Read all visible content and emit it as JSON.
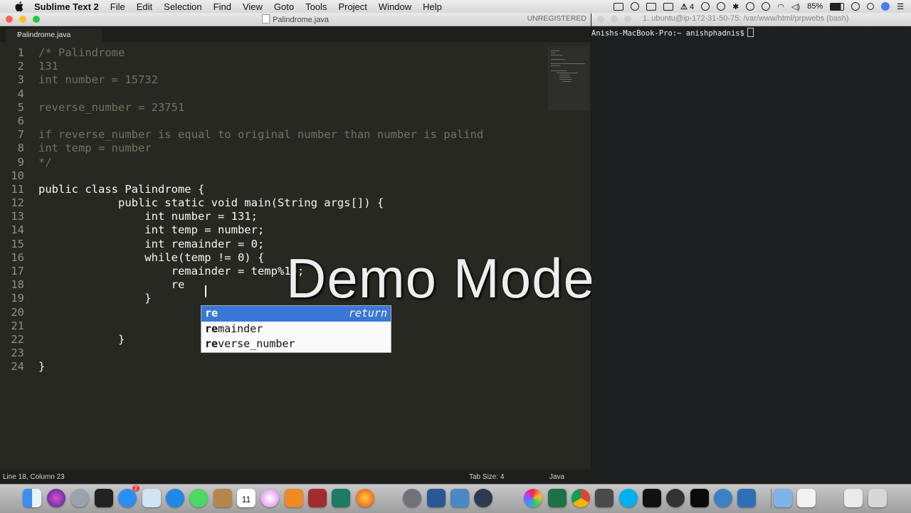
{
  "menubar": {
    "app_name": "Sublime Text 2",
    "items": [
      "File",
      "Edit",
      "Selection",
      "Find",
      "View",
      "Goto",
      "Tools",
      "Project",
      "Window",
      "Help"
    ],
    "status": {
      "notification_count": "4",
      "battery": "85%"
    }
  },
  "sublime": {
    "window_title": "Palindrome.java",
    "unregistered": "UNREGISTERED",
    "tab_label": "Palindrome.java",
    "line_numbers": [
      "1",
      "2",
      "3",
      "4",
      "5",
      "6",
      "7",
      "8",
      "9",
      "10",
      "11",
      "12",
      "13",
      "14",
      "15",
      "16",
      "17",
      "18",
      "19",
      "20",
      "21",
      "22",
      "23",
      "24"
    ],
    "code_lines": [
      "/* Palindrome",
      "131",
      "int number = 15732",
      "",
      "reverse_number = 23751",
      "",
      "if reverse_number is equal to original number than number is palind",
      "int temp = number",
      "*/",
      "",
      "public class Palindrome {",
      "            public static void main(String args[]) {",
      "                int number = 131;",
      "                int temp = number;",
      "                int remainder = 0;",
      "                while(temp != 0) {",
      "                    remainder = temp%10;",
      "                    re",
      "                }",
      "",
      "",
      "            }",
      "",
      "}"
    ],
    "autocomplete": [
      {
        "match": "re",
        "rest": "",
        "hint": "return"
      },
      {
        "match": "re",
        "rest": "mainder",
        "hint": ""
      },
      {
        "match": "re",
        "rest": "verse_number",
        "hint": ""
      }
    ],
    "overlay_text": "Demo Mode",
    "status_position": "Line 18, Column 23",
    "status_tab_size": "Tab Size: 4",
    "status_syntax": "Java"
  },
  "terminal": {
    "title": "1. ubuntu@ip-172-31-50-75: /var/www/html/prpwebs (bash)",
    "prompt": "Anishs-MacBook-Pro:~ anishphadnis$"
  },
  "dock": {
    "apps": [
      "finder",
      "siri",
      "launchpad",
      "photo-booth",
      "app-store",
      "preview",
      "safari",
      "messages",
      "contacts",
      "calendar",
      "itunes",
      "ibooks",
      "photo-app",
      "palm-app",
      "firefox",
      "system-preferences",
      "word",
      "remote-desktop",
      "quicktime",
      "photos",
      "excel",
      "chrome",
      "sublime-text",
      "skype",
      "terminal",
      "github",
      "iterm",
      "instruments",
      "xcode",
      "folder",
      "documents",
      "downloads",
      "trash"
    ],
    "calendar_day": "11",
    "appstore_badge": "2"
  }
}
